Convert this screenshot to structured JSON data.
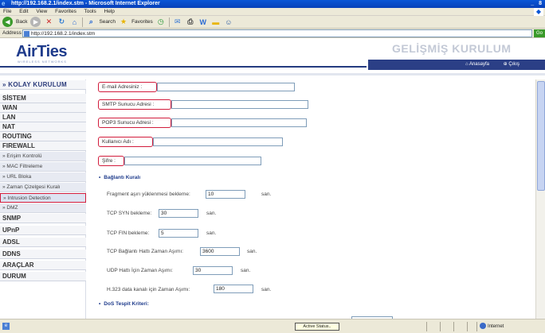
{
  "window": {
    "title": "http://192.168.2.1/index.stm - Microsoft Internet Explorer",
    "controls": "_ 8"
  },
  "menubar": [
    "File",
    "Edit",
    "View",
    "Favorites",
    "Tools",
    "Help"
  ],
  "toolbar": {
    "back_label": "Back",
    "search_label": "Search",
    "favorites_label": "Favorites"
  },
  "address": {
    "label": "Address",
    "url": "http://192.168.2.1/index.stm",
    "go_label": "Go"
  },
  "header": {
    "logo_text": "AirTies",
    "logo_tagline": "WIRELESS NETWORKS",
    "page_title": "GELİŞMİŞ KURULUM",
    "links": [
      "Anasayfa",
      "Çıkış"
    ]
  },
  "sidebar": {
    "items": [
      {
        "label": "» KOLAY KURULUM",
        "type": "top"
      },
      {
        "label": "SİSTEM",
        "type": "main"
      },
      {
        "label": "WAN",
        "type": "main"
      },
      {
        "label": "LAN",
        "type": "main"
      },
      {
        "label": "NAT",
        "type": "main"
      },
      {
        "label": "ROUTING",
        "type": "main"
      },
      {
        "label": "FIREWALL",
        "type": "main"
      },
      {
        "label": "» Erişim Kontrolü",
        "type": "sub"
      },
      {
        "label": "» MAC Filtreleme",
        "type": "sub"
      },
      {
        "label": "» URL Bloka",
        "type": "sub"
      },
      {
        "label": "» Zaman Çizelgesi Kuralı",
        "type": "sub"
      },
      {
        "label": "» Intrusion Detection",
        "type": "sub",
        "highlighted": true
      },
      {
        "label": "» DMZ",
        "type": "sub"
      },
      {
        "label": "SNMP",
        "type": "main"
      },
      {
        "label": "UPnP",
        "type": "main"
      },
      {
        "label": "ADSL",
        "type": "main"
      },
      {
        "label": "DDNS",
        "type": "main"
      },
      {
        "label": "ARAÇLAR",
        "type": "main"
      },
      {
        "label": "DURUM",
        "type": "main"
      }
    ]
  },
  "form": {
    "email_label": "E-mail Adresiniz :",
    "smtp_label": "SMTP Sunucu Adresi :",
    "pop3_label": "POP3 Sunucu Adresi :",
    "username_label": "Kullanıcı Adı :",
    "password_label": "Şifre :",
    "email_value": "",
    "smtp_value": "",
    "pop3_value": "",
    "username_value": "",
    "password_value": ""
  },
  "connection_policy": {
    "title": "Bağlantı Kuralı",
    "rows": [
      {
        "label": "Fragment aşırı yüklenmesi bekleme:",
        "value": "10",
        "unit": "san."
      },
      {
        "label": "TCP SYN bekleme:",
        "value": "30",
        "unit": "san."
      },
      {
        "label": "TCP FIN bekleme:",
        "value": "5",
        "unit": "san."
      },
      {
        "label": "TCP Bağlantı Hattı Zaman Aşımı:",
        "value": "3600",
        "unit": "san."
      },
      {
        "label": "UDP Hattı İçin Zaman Aşımı:",
        "value": "30",
        "unit": "san."
      },
      {
        "label": "H.323 data kanalı için Zaman Aşımı:",
        "value": "180",
        "unit": "san."
      }
    ]
  },
  "dos_section": {
    "title": "DoS Tespit Kriteri:"
  },
  "statusbar": {
    "message": "Active Status..",
    "zone": "Internet"
  }
}
